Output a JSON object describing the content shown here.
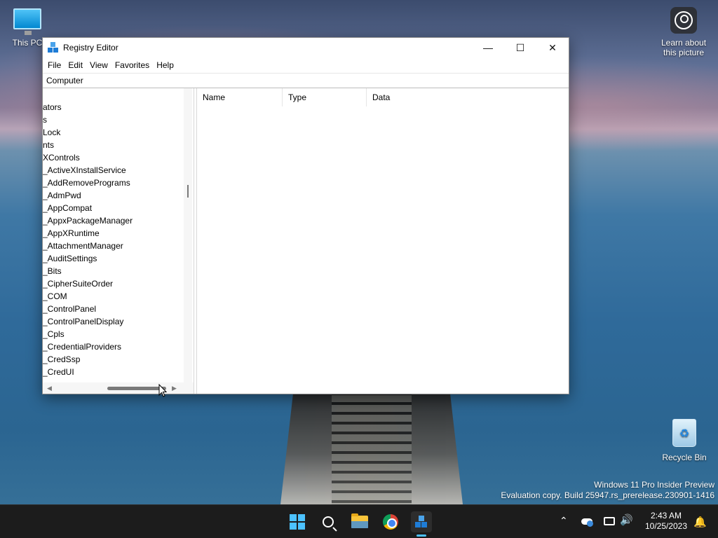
{
  "desktop": {
    "this_pc_label": "This PC",
    "learn_label": "Learn about this picture",
    "recycle_label": "Recycle Bin",
    "watermark_line1": "Windows 11 Pro Insider Preview",
    "watermark_line2": "Evaluation copy. Build 25947.rs_prerelease.230901-1416"
  },
  "window": {
    "title": "Registry Editor",
    "menu": [
      "File",
      "Edit",
      "View",
      "Favorites",
      "Help"
    ],
    "address": "Computer",
    "tree_items": [
      "ators",
      "s",
      "Lock",
      "nts",
      "XControls",
      "_ActiveXInstallService",
      "_AddRemovePrograms",
      "_AdmPwd",
      "_AppCompat",
      "_AppxPackageManager",
      "_AppXRuntime",
      "_AttachmentManager",
      "_AuditSettings",
      "_Bits",
      "_CipherSuiteOrder",
      "_COM",
      "_ControlPanel",
      "_ControlPanelDisplay",
      "_Cpls",
      "_CredentialProviders",
      "_CredSsp",
      "_CredUI"
    ],
    "columns": {
      "name": "Name",
      "type": "Type",
      "data": "Data"
    }
  },
  "taskbar": {
    "time": "2:43 AM",
    "date": "10/25/2023",
    "accent": "#4cc2ff",
    "apps": [
      "start-icon",
      "search-icon",
      "file-explorer-icon",
      "chrome-icon",
      "registry-editor-icon"
    ]
  }
}
